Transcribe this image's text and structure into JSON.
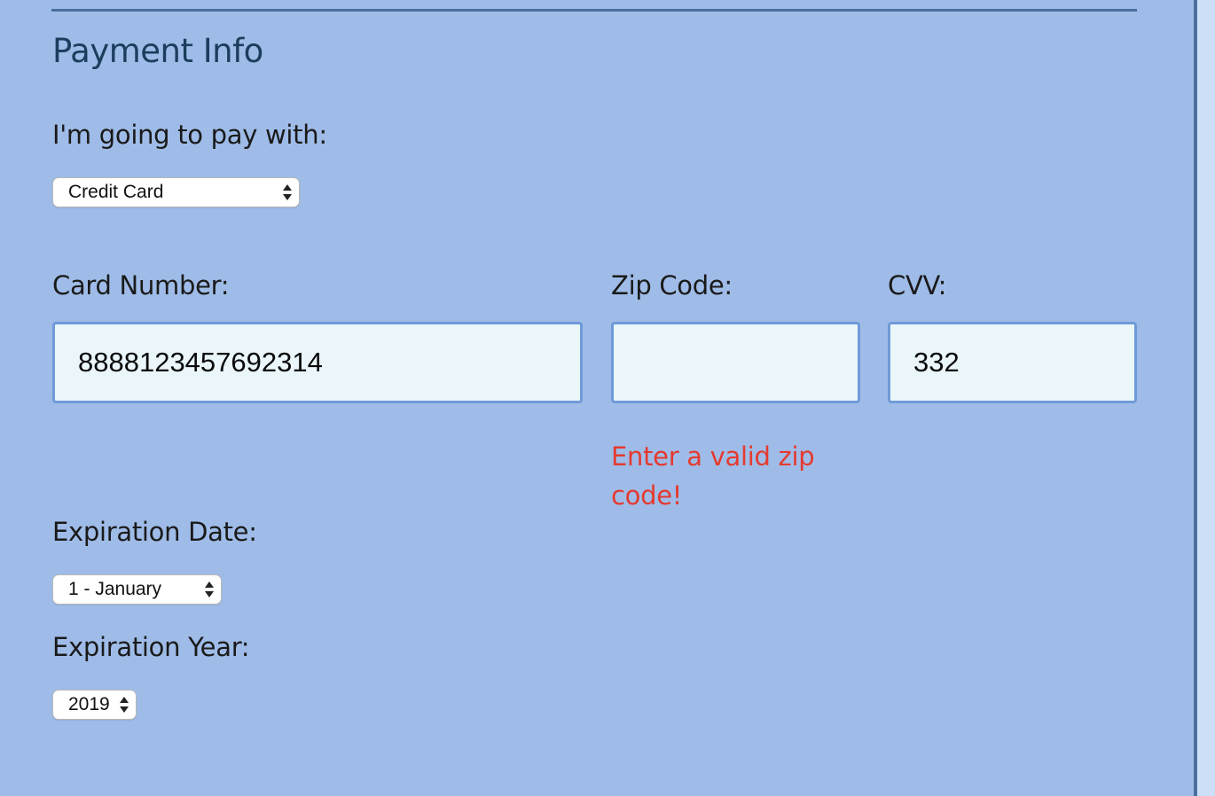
{
  "section": {
    "title": "Payment Info"
  },
  "payment_method": {
    "label": "I'm going to pay with:",
    "selected": "Credit Card"
  },
  "card_number": {
    "label": "Card Number:",
    "value": "8888123457692314"
  },
  "zip": {
    "label": "Zip Code:",
    "value": "",
    "error": "Enter a valid zip code!"
  },
  "cvv": {
    "label": "CVV:",
    "value": "332"
  },
  "exp_month": {
    "label": "Expiration Date:",
    "selected": "1 - January"
  },
  "exp_year": {
    "label": "Expiration Year:",
    "selected": "2019"
  },
  "colors": {
    "background": "#9fbce8",
    "legend": "#1c3e5d",
    "input_bg": "#eaf6fa",
    "input_border": "#6f9ad8",
    "error": "#e53a2f"
  }
}
